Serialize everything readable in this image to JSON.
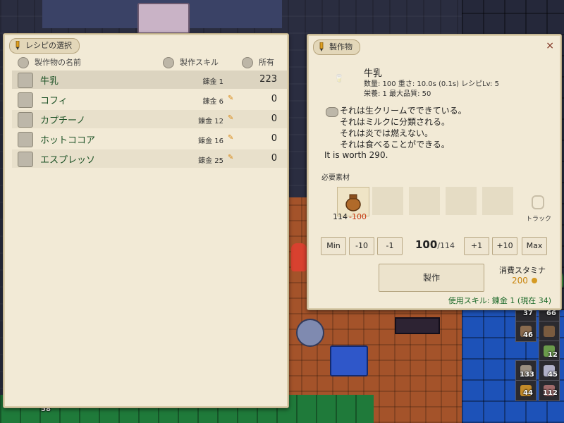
{
  "recipe_panel": {
    "tab_label": "レシピの選択",
    "columns": {
      "name": "製作物の名前",
      "skill": "製作スキル",
      "owned": "所有"
    },
    "items": [
      {
        "name": "牛乳",
        "skill": "錬金 1",
        "owned": "223",
        "warn": false
      },
      {
        "name": "コフィ",
        "skill": "錬金 6",
        "owned": "0",
        "warn": true
      },
      {
        "name": "カプチーノ",
        "skill": "錬金 12",
        "owned": "0",
        "warn": true
      },
      {
        "name": "ホットココア",
        "skill": "錬金 16",
        "owned": "0",
        "warn": true
      },
      {
        "name": "エスプレッソ",
        "skill": "錬金 25",
        "owned": "0",
        "warn": true
      }
    ]
  },
  "detail_panel": {
    "tab_label": "製作物",
    "close_icon": "×",
    "product_name": "牛乳",
    "stats_line1": "数量: 100  重さ: 10.0s (0.1s)  レシピLv: 5",
    "stats_line2": "栄養: 1  最大品質: 50",
    "description": [
      "それは生クリームでできている。",
      "それはミルクに分類される。",
      "それは炎では燃えない。",
      "それは食べることができる。"
    ],
    "worth": "It is worth 290.",
    "materials_label": "必要素材",
    "material_count": "114",
    "material_use": "-100",
    "track_label": "トラック",
    "buttons": {
      "min": "Min",
      "minus10": "-10",
      "minus1": "-1",
      "plus1": "+1",
      "plus10": "+10",
      "max": "Max"
    },
    "quantity": "100",
    "quantity_max": "/114",
    "craft_label": "製作",
    "stamina_label": "消費スタミナ",
    "stamina_value": "200",
    "skill_used": "使用スキル: 錬金 1 (現在 34)"
  },
  "inventory_counts": [
    "37",
    "66",
    "46",
    "12",
    "133",
    "45",
    "44",
    "112"
  ],
  "corner_count": "58"
}
